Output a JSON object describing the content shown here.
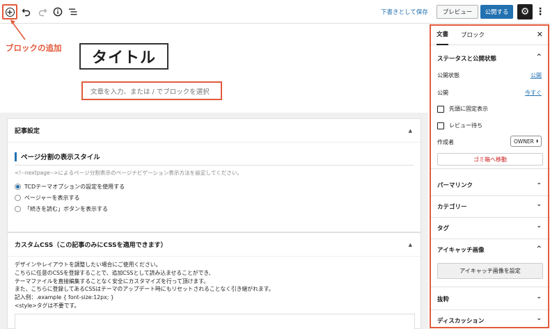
{
  "toolbar": {
    "save_draft": "下書きとして保存",
    "preview": "プレビュー",
    "publish": "公開する"
  },
  "annotation": {
    "add_block": "ブロックの追加"
  },
  "editor": {
    "title": "タイトル",
    "paragraph_placeholder": "文章を入力、または / でブロックを選択"
  },
  "meta": {
    "article_settings": {
      "heading": "記事設定",
      "pagebreak_title": "ページ分割の表示スタイル",
      "pagebreak_desc": "<!--nextpage-->によるページ分割表示のページナビゲーション表示方法を設定してください。",
      "options": [
        "TCDテーマオプションの設定を使用する",
        "ページャーを表示する",
        "「続きを読む」ボタンを表示する"
      ],
      "selected_index": 0
    },
    "custom_css": {
      "heading": "カスタムCSS（この記事のみにCSSを適用できます）",
      "lines": [
        "デザインやレイアウトを調整したい場合にご使用ください。",
        "こちらに任意のCSSを登録することで、追加CSSとして読み込ませることができ、",
        "テーマファイルを直接編集することなく安全にカスタマイズを行って頂けます。",
        "また、こちらに登録してあるCSSはテーマのアップデート時にもリセットされることなく引き継がれます。",
        "記入例：.example { font-size:12px; }",
        "<style>タグは不要です。"
      ]
    }
  },
  "sidebar": {
    "tabs": [
      "文書",
      "ブロック"
    ],
    "active_tab": 0,
    "status": {
      "heading": "ステータスと公開状態",
      "visibility_label": "公開状態",
      "visibility_value": "公開",
      "publish_label": "公開",
      "publish_value": "今すぐ",
      "sticky_label": "先頭に固定表示",
      "pending_label": "レビュー待ち",
      "author_label": "作成者",
      "author_value": "OWNER",
      "trash_label": "ゴミ箱へ移動"
    },
    "sections": {
      "permalink": "パーマリンク",
      "categories": "カテゴリー",
      "tags": "タグ",
      "featured_image": "アイキャッチ画像",
      "featured_image_button": "アイキャッチ画像を設定",
      "excerpt": "抜粋",
      "discussion": "ディスカッション"
    }
  },
  "colors": {
    "accent": "#2271b1",
    "annotation": "#e25a3b",
    "danger": "#cc1818"
  }
}
